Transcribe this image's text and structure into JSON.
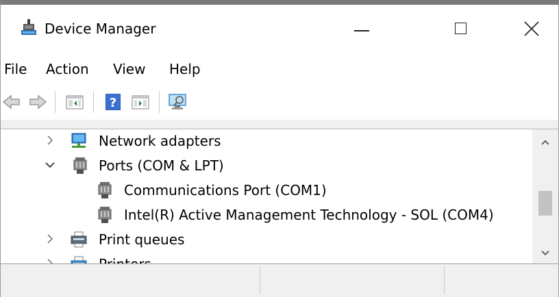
{
  "window": {
    "title": "Device Manager",
    "controls": {
      "minimize": "minimize",
      "maximize": "maximize",
      "close": "close"
    }
  },
  "menubar": {
    "items": [
      "File",
      "Action",
      "View",
      "Help"
    ]
  },
  "toolbar": {
    "icons": [
      "back-arrow-icon",
      "forward-arrow-icon",
      "show-hide-console-tree-icon",
      "help-icon",
      "properties-icon",
      "scan-hardware-icon"
    ]
  },
  "tree": {
    "items": [
      {
        "label": "Network adapters",
        "state": "collapsed",
        "icon": "network-adapter-icon"
      },
      {
        "label": "Ports (COM & LPT)",
        "state": "expanded",
        "icon": "port-icon"
      },
      {
        "label": "Communications Port (COM1)",
        "state": "leaf",
        "icon": "port-icon"
      },
      {
        "label": "Intel(R) Active Management Technology - SOL (COM4)",
        "state": "leaf",
        "icon": "port-icon"
      },
      {
        "label": "Print queues",
        "state": "collapsed",
        "icon": "printer-icon"
      },
      {
        "label": "Printers",
        "state": "collapsed",
        "icon": "printer-icon"
      }
    ]
  },
  "statusbar": {
    "panes": [
      "",
      "",
      ""
    ]
  },
  "colors": {
    "accent": "#0078d7",
    "chrome": "#f0f0f0",
    "title_border": "#7a7a7a"
  }
}
